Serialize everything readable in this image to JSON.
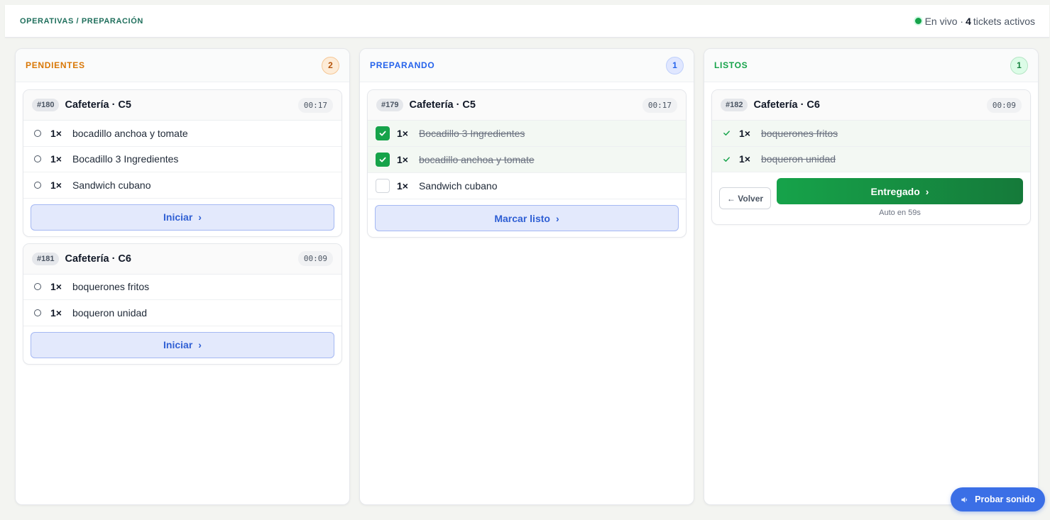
{
  "header": {
    "breadcrumb": "OPERATIVAS / PREPARACIÓN",
    "live_label": "En vivo ·",
    "active_count": "4",
    "active_label": "tickets activos"
  },
  "columns": [
    {
      "title": "PENDIENTES",
      "count": "2",
      "tickets": [
        {
          "id": "#180",
          "name": "Cafetería · C5",
          "timer": "00:17",
          "items": [
            {
              "qty": "1×",
              "name": "bocadillo anchoa y tomate"
            },
            {
              "qty": "1×",
              "name": "Bocadillo 3 Ingredientes"
            },
            {
              "qty": "1×",
              "name": "Sandwich cubano"
            }
          ],
          "action": "Iniciar"
        },
        {
          "id": "#181",
          "name": "Cafetería · C6",
          "timer": "00:09",
          "items": [
            {
              "qty": "1×",
              "name": "boquerones fritos"
            },
            {
              "qty": "1×",
              "name": "boqueron unidad"
            }
          ],
          "action": "Iniciar"
        }
      ]
    },
    {
      "title": "PREPARANDO",
      "count": "1",
      "tickets": [
        {
          "id": "#179",
          "name": "Cafetería · C5",
          "timer": "00:17",
          "items": [
            {
              "qty": "1×",
              "name": "Bocadillo 3 Ingredientes",
              "done": true
            },
            {
              "qty": "1×",
              "name": "bocadillo anchoa y tomate",
              "done": true
            },
            {
              "qty": "1×",
              "name": "Sandwich cubano",
              "done": false
            }
          ],
          "action": "Marcar listo"
        }
      ]
    },
    {
      "title": "LISTOS",
      "count": "1",
      "tickets": [
        {
          "id": "#182",
          "name": "Cafetería · C6",
          "timer": "00:09",
          "items": [
            {
              "qty": "1×",
              "name": "boquerones fritos",
              "done": true
            },
            {
              "qty": "1×",
              "name": "boqueron unidad",
              "done": true
            }
          ],
          "back_label": "← Volver",
          "action": "Entregado",
          "auto_note": "Auto en 59s"
        }
      ]
    }
  ],
  "sound_button": "Probar sonido",
  "icons": {
    "chevron": "chevron-right-icon",
    "check": "check-icon",
    "speaker": "speaker-icon",
    "live": "live-dot-icon"
  },
  "colors": {
    "pending": "#d97706",
    "preparing": "#2563eb",
    "ready": "#16a34a",
    "breadcrumb": "#1f6f5c"
  }
}
